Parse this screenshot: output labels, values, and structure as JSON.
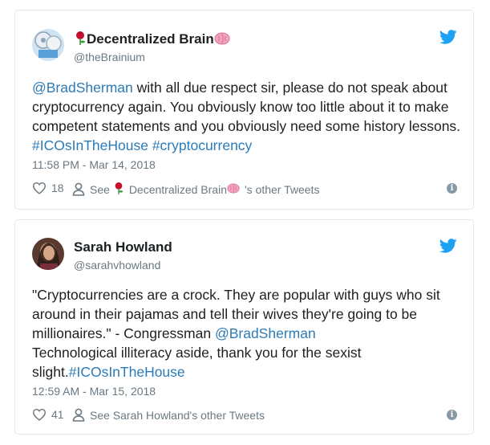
{
  "tweets": [
    {
      "name_prefix_icon": "rose-icon",
      "name": "Decentralized Brain",
      "name_suffix_icon": "brain-icon",
      "handle": "@theBrainium",
      "mention": "@BradSherman",
      "text": " with all due respect sir, please do not speak about cryptocurrency again. You obviously know too little about it to make competent statements and you obviously need some history lessons. ",
      "hashtag1": "#ICOsInTheHouse",
      "hashtag2": "#cryptocurrency",
      "timestamp": "11:58 PM - Mar 14, 2018",
      "likes": "18",
      "see_prefix": "See ",
      "see_name": "Decentralized Brain",
      "see_suffix": "'s other Tweets"
    },
    {
      "name": "Sarah Howland",
      "handle": "@sarahvhowland",
      "text_a": "\"Cryptocurrencies are a crock. They are popular with guys who sit around in their pajamas and tell their wives they're going to be millionaires.\" - Congressman ",
      "mention": "@BradSherman",
      "text_b": "Technological illiteracy aside, thank you for the sexist slight.",
      "hashtag1": "#ICOsInTheHouse",
      "timestamp": "12:59 AM - Mar 15, 2018",
      "likes": "41",
      "see_label": "See Sarah Howland's other Tweets"
    }
  ],
  "colors": {
    "link": "#2b7bb9",
    "twitter_blue": "#1da1f2",
    "muted": "#697882",
    "rose": "#c8102e",
    "brain": "#f28cb1"
  },
  "icons": {
    "bird": "twitter-bird-icon",
    "heart": "heart-icon",
    "person": "person-icon",
    "info": "info-icon"
  }
}
